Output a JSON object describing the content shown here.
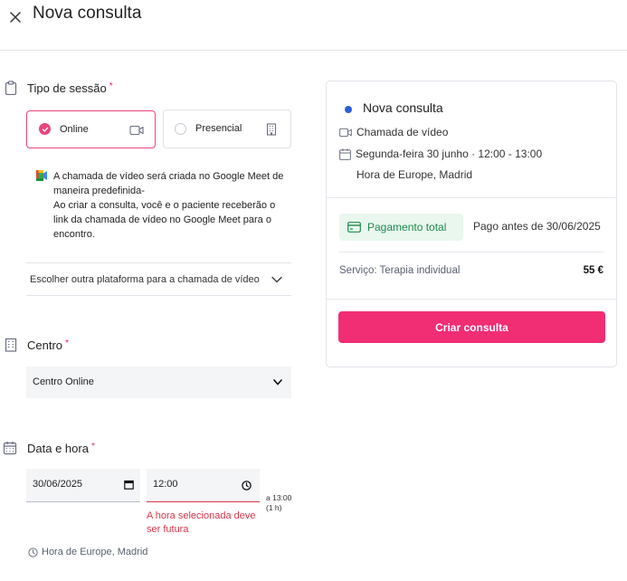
{
  "header": {
    "title": "Nova consulta"
  },
  "session": {
    "label": "Tipo de sessão",
    "required_mark": "*",
    "options": [
      {
        "label": "Online",
        "selected": true
      },
      {
        "label": "Presencial",
        "selected": false
      }
    ],
    "info_line1": "A chamada de vídeo será criada no Google Meet de maneira predefinida-",
    "info_line2": "Ao criar a consulta, você e o paciente receberão o link da chamada de vídeo no Google Meet para o encontro.",
    "platform_select": "Escolher outra plataforma para a chamada de vídeo"
  },
  "centro": {
    "label": "Centro",
    "required_mark": "*",
    "value": "Centro Online"
  },
  "datetime": {
    "label": "Data e hora",
    "required_mark": "*",
    "date_value": "30/06/2025",
    "time_value": "12:00",
    "end_line1": "a 13:00",
    "end_line2": "(1 h)",
    "error": "A hora selecionada deve ser futura",
    "timezone": "Hora de Europe, Madrid"
  },
  "summary": {
    "title": "Nova consulta",
    "call_type": "Chamada de vídeo",
    "datetime": "Segunda-feira 30 junho · 12:00 - 13:00",
    "timezone": "Hora de Europe, Madrid",
    "payment_badge": "Pagamento total",
    "payment_due": "Pago antes de 30/06/2025",
    "service_label": "Serviço: Terapia individual",
    "service_price": "55 €",
    "create_button": "Criar consulta"
  },
  "colors": {
    "accent": "#f12d74",
    "selected_border": "#e8457a",
    "error": "#d9364a",
    "payment_green": "#1d8a4a",
    "payment_bg": "#e9f7ee",
    "title_dot": "#2c5fd6"
  }
}
